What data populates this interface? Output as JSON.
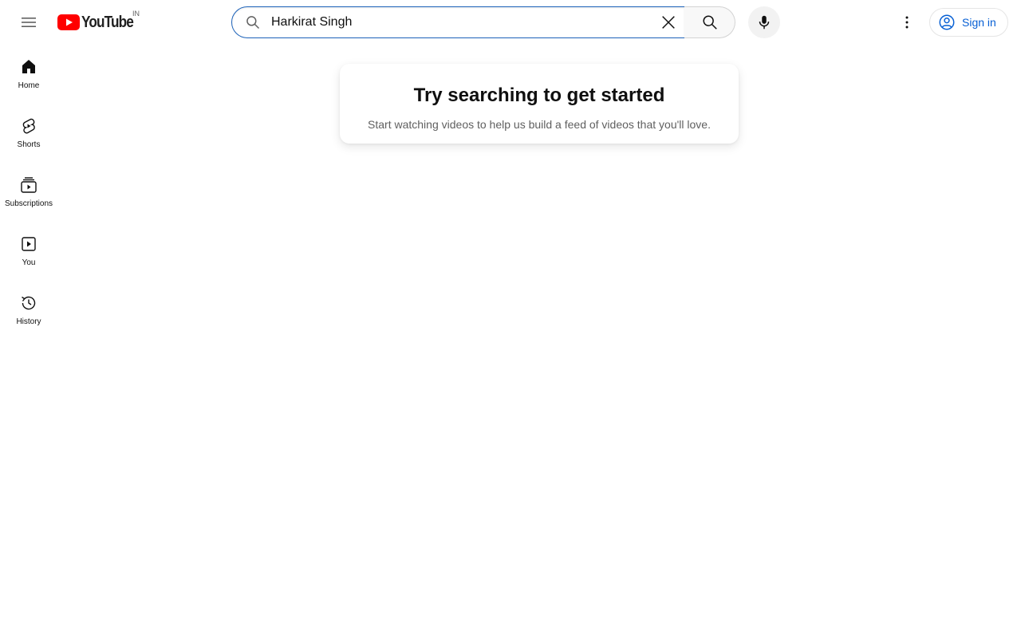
{
  "masthead": {
    "logo_text": "YouTube",
    "logo_country": "IN",
    "search": {
      "value": "Harkirat Singh",
      "placeholder": "Search"
    },
    "signin_label": "Sign in",
    "icons": {
      "menu": "hamburger-menu-icon",
      "search": "search-icon",
      "clear": "close-icon",
      "mic": "microphone-icon",
      "more": "more-vertical-icon",
      "account": "account-circle-icon"
    }
  },
  "guide": {
    "items": [
      {
        "label": "Home",
        "icon": "home-icon"
      },
      {
        "label": "Shorts",
        "icon": "shorts-icon"
      },
      {
        "label": "Subscriptions",
        "icon": "subscriptions-icon"
      },
      {
        "label": "You",
        "icon": "you-icon"
      },
      {
        "label": "History",
        "icon": "history-icon"
      }
    ]
  },
  "promo": {
    "title": "Try searching to get started",
    "subtitle": "Start watching videos to help us build a feed of videos that you'll love."
  },
  "colors": {
    "brand_red": "#ff0000",
    "link_blue": "#065fd4",
    "focus_border": "#1c62b9"
  }
}
